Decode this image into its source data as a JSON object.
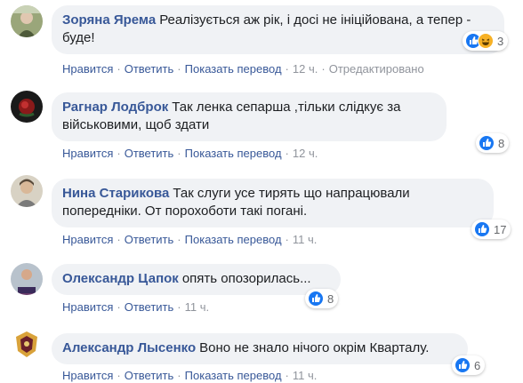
{
  "comments": [
    {
      "author": "Зоряна Ярема",
      "text": "Реалізується аж рік, і досі не ініційована, а тепер - буде!",
      "reaction_count": "3",
      "reactions": [
        "like-icon",
        "haha-icon"
      ],
      "like_label": "Нравится",
      "reply_label": "Ответить",
      "translate_label": "Показать перевод",
      "time": "12 ч.",
      "edited_label": "Отредактировано"
    },
    {
      "author": "Рагнар Лодброк",
      "text": "Так ленка сепарша ,тільки слідкує за військовими, щоб здати",
      "reaction_count": "8",
      "reactions": [
        "like-icon"
      ],
      "like_label": "Нравится",
      "reply_label": "Ответить",
      "translate_label": "Показать перевод",
      "time": "12 ч."
    },
    {
      "author": "Нина Старикова",
      "text": "Так слуги усе тирять що напрацювали попередніки. От порохоботи такі погані.",
      "reaction_count": "17",
      "reactions": [
        "like-icon"
      ],
      "like_label": "Нравится",
      "reply_label": "Ответить",
      "translate_label": "Показать перевод",
      "time": "11 ч."
    },
    {
      "author": "Олександр Цапок",
      "text": "опять опозорилась...",
      "reaction_count": "8",
      "reactions": [
        "like-icon"
      ],
      "like_label": "Нравится",
      "reply_label": "Ответить",
      "time": "11 ч."
    },
    {
      "author": "Александр Лысенко",
      "text": "Воно не знало нічого окрім Кварталу.",
      "reaction_count": "6",
      "reactions": [
        "like-icon"
      ],
      "like_label": "Нравится",
      "reply_label": "Ответить",
      "translate_label": "Показать перевод",
      "time": "11 ч."
    }
  ],
  "colors": {
    "author": "#385898",
    "bubble": "#f0f2f5",
    "like": "#1877f2",
    "haha": "#f7b125"
  }
}
